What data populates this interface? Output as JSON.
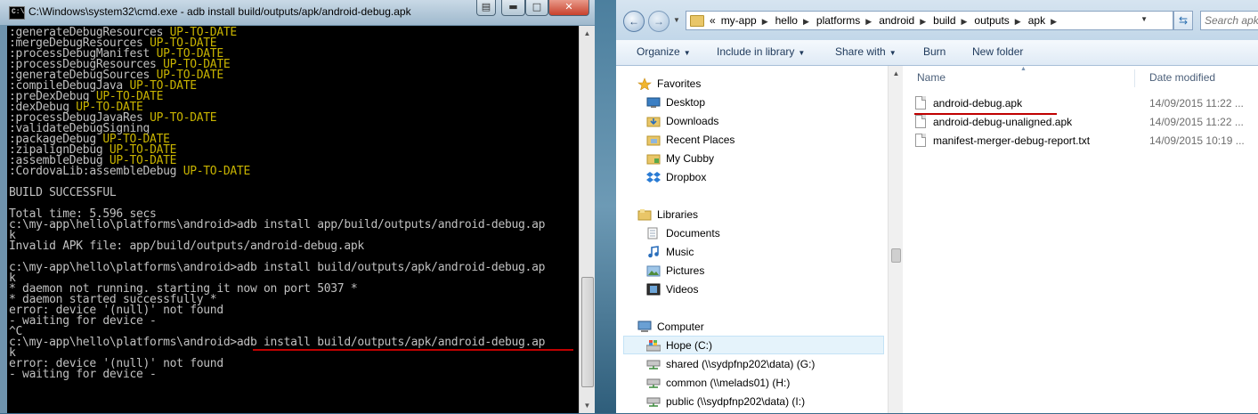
{
  "cmd": {
    "title": "C:\\Windows\\system32\\cmd.exe - adb  install build/outputs/apk/android-debug.apk",
    "icon": "cmd-icon",
    "lines": [
      {
        "t": ":generateDebugResources ",
        "s": "UP-TO-DATE"
      },
      {
        "t": ":mergeDebugResources ",
        "s": "UP-TO-DATE"
      },
      {
        "t": ":processDebugManifest ",
        "s": "UP-TO-DATE"
      },
      {
        "t": ":processDebugResources ",
        "s": "UP-TO-DATE"
      },
      {
        "t": ":generateDebugSources ",
        "s": "UP-TO-DATE"
      },
      {
        "t": ":compileDebugJava ",
        "s": "UP-TO-DATE"
      },
      {
        "t": ":preDexDebug ",
        "s": "UP-TO-DATE"
      },
      {
        "t": ":dexDebug ",
        "s": "UP-TO-DATE"
      },
      {
        "t": ":processDebugJavaRes ",
        "s": "UP-TO-DATE"
      },
      {
        "t": ":validateDebugSigning",
        "s": ""
      },
      {
        "t": ":packageDebug ",
        "s": "UP-TO-DATE"
      },
      {
        "t": ":zipalignDebug ",
        "s": "UP-TO-DATE"
      },
      {
        "t": ":assembleDebug ",
        "s": "UP-TO-DATE"
      },
      {
        "t": ":CordovaLib:assembleDebug ",
        "s": "UP-TO-DATE"
      },
      {
        "t": "",
        "s": ""
      },
      {
        "t": "BUILD SUCCESSFUL",
        "s": ""
      },
      {
        "t": "",
        "s": ""
      },
      {
        "t": "Total time: 5.596 secs",
        "s": ""
      },
      {
        "t": "c:\\my-app\\hello\\platforms\\android>adb install app/build/outputs/android-debug.ap",
        "s": ""
      },
      {
        "t": "k",
        "s": ""
      },
      {
        "t": "Invalid APK file: app/build/outputs/android-debug.apk",
        "s": ""
      },
      {
        "t": "",
        "s": ""
      },
      {
        "t": "c:\\my-app\\hello\\platforms\\android>adb install build/outputs/apk/android-debug.ap",
        "s": ""
      },
      {
        "t": "k",
        "s": ""
      },
      {
        "t": "* daemon not running. starting it now on port 5037 *",
        "s": ""
      },
      {
        "t": "* daemon started successfully *",
        "s": ""
      },
      {
        "t": "error: device '(null)' not found",
        "s": ""
      },
      {
        "t": "- waiting for device -",
        "s": ""
      },
      {
        "t": "^C",
        "s": ""
      },
      {
        "t": "c:\\my-app\\hello\\platforms\\android>adb install build/outputs/apk/android-debug.ap",
        "s": ""
      },
      {
        "t": "k",
        "s": ""
      },
      {
        "t": "error: device '(null)' not found",
        "s": ""
      },
      {
        "t": "- waiting for device -",
        "s": ""
      }
    ],
    "controls": {
      "sysmenu": "▤",
      "minimize": "▬",
      "maximize": "□",
      "close": "✕"
    }
  },
  "explorer": {
    "address": [
      "«",
      "my-app",
      "hello",
      "platforms",
      "android",
      "build",
      "outputs",
      "apk"
    ],
    "search_placeholder": "Search apk",
    "toolbar": {
      "organize": "Organize",
      "include_in_library": "Include in library",
      "share_with": "Share with",
      "burn": "Burn",
      "new_folder": "New folder"
    },
    "nav": {
      "favorites": "Favorites",
      "desktop": "Desktop",
      "downloads": "Downloads",
      "recent_places": "Recent Places",
      "my_cubby": "My Cubby",
      "dropbox": "Dropbox",
      "libraries": "Libraries",
      "documents": "Documents",
      "music": "Music",
      "pictures": "Pictures",
      "videos": "Videos",
      "computer": "Computer",
      "drive_c": "Hope (C:)",
      "drive_g": "shared (\\\\sydpfnp202\\data) (G:)",
      "drive_h": "common (\\\\melads01) (H:)",
      "drive_i": "public (\\\\sydpfnp202\\data) (I:)"
    },
    "columns": {
      "name": "Name",
      "date_modified": "Date modified"
    },
    "files": [
      {
        "name": "android-debug.apk",
        "date": "14/09/2015 11:22 ..."
      },
      {
        "name": "android-debug-unaligned.apk",
        "date": "14/09/2015 11:22 ..."
      },
      {
        "name": "manifest-merger-debug-report.txt",
        "date": "14/09/2015 10:19 ..."
      }
    ]
  },
  "colors": {
    "console_bg": "#000000",
    "console_text": "#c0c0c0",
    "up_to_date": "#c8b400",
    "annotation": "#c00000",
    "close_btn": "#c8412c"
  }
}
